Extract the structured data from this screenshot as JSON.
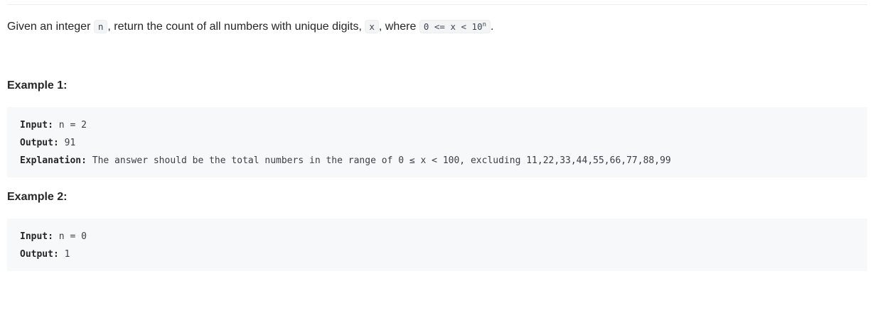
{
  "description": {
    "text_1": "Given an integer ",
    "code_n": "n",
    "text_2": ", return the count of all numbers with unique digits, ",
    "code_x": "x",
    "text_3": ", where ",
    "code_range": "0 <= x < 10",
    "code_range_sup": "n",
    "text_4": "."
  },
  "examples": [
    {
      "heading": "Example 1:",
      "input_label": "Input:",
      "input_value": "n = 2",
      "output_label": "Output:",
      "output_value": "91",
      "explanation_label": "Explanation:",
      "explanation_value": "The answer should be the total numbers in the range of 0 ≤ x < 100, excluding 11,22,33,44,55,66,77,88,99"
    },
    {
      "heading": "Example 2:",
      "input_label": "Input:",
      "input_value": "n = 0",
      "output_label": "Output:",
      "output_value": "1"
    }
  ]
}
